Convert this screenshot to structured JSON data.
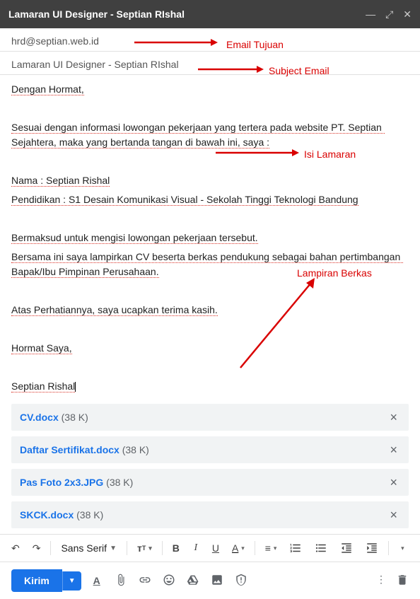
{
  "header": {
    "title": "Lamaran UI Designer - Septian RIshal"
  },
  "to": "hrd@septian.web.id",
  "subject": "Lamaran UI Designer - Septian RIshal",
  "body": {
    "greeting": "Dengan Hormat,",
    "p1": "Sesuai dengan informasi lowongan pekerjaan yang tertera pada website PT. Septian Sejahtera, maka yang bertanda tangan di bawah ini, saya :",
    "name_line": "Nama : Septian Rishal",
    "edu_line": "Pendidikan : S1 Desain Komunikasi Visual - Sekolah Tinggi Teknologi Bandung",
    "p2a": "Bermaksud untuk mengisi lowongan pekerjaan tersebut.",
    "p2b": "Bersama ini saya lampirkan CV beserta berkas pendukung sebagai bahan pertimbangan Bapak/Ibu Pimpinan Perusahaan.",
    "p3": "Atas Perhatiannya, saya ucapkan terima kasih.",
    "closing": "Hormat Saya,",
    "signature": "Septian Rishal"
  },
  "attachments": [
    {
      "name": "CV.docx",
      "size": "(38 K)"
    },
    {
      "name": "Daftar Sertifikat.docx",
      "size": "(38 K)"
    },
    {
      "name": "Pas Foto 2x3.JPG",
      "size": "(38 K)"
    },
    {
      "name": "SKCK.docx",
      "size": "(38 K)"
    }
  ],
  "toolbar": {
    "font": "Sans Serif"
  },
  "send": {
    "label": "Kirim"
  },
  "annotations": {
    "to": "Email Tujuan",
    "subject": "Subject Email",
    "body": "Isi Lamaran",
    "attach": "Lampiran Berkas"
  }
}
